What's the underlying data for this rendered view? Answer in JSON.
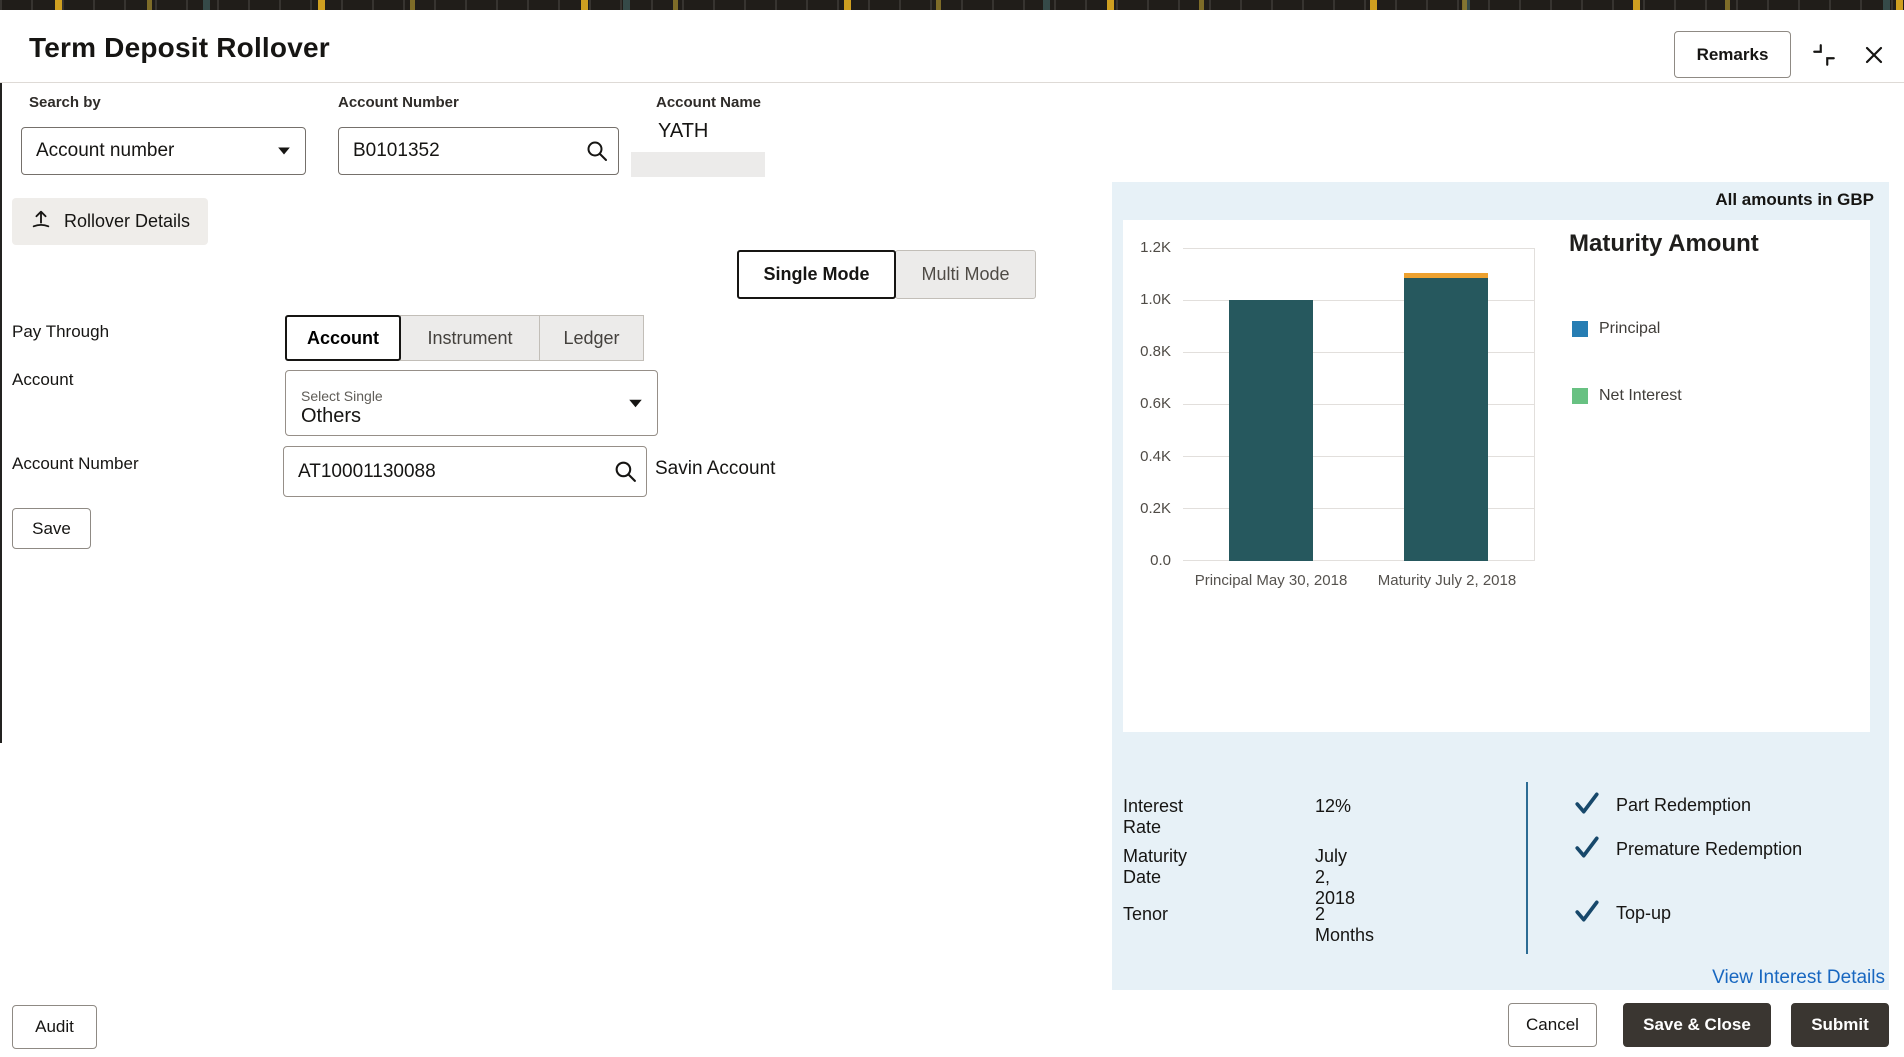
{
  "header": {
    "title": "Term Deposit Rollover",
    "remarks_label": "Remarks"
  },
  "search": {
    "search_by_label": "Search by",
    "search_by_value": "Account number",
    "account_number_label": "Account Number",
    "account_number_value": "B0101352",
    "account_name_label": "Account Name",
    "account_name_value": "YATH"
  },
  "form": {
    "rollover_details_label": "Rollover Details",
    "modes": {
      "single": "Single Mode",
      "multi": "Multi Mode",
      "selected": "Single Mode"
    },
    "pay_through_label": "Pay Through",
    "pay_through_tabs": [
      "Account",
      "Instrument",
      "Ledger"
    ],
    "pay_through_selected": "Account",
    "account_label": "Account",
    "account_select_label": "Select Single",
    "account_select_value": "Others",
    "account_number_label": "Account Number",
    "account_number_value": "AT10001130088",
    "account_number_hint": "Savin Account",
    "save_label": "Save"
  },
  "summary": {
    "amounts_note": "All amounts in GBP",
    "details": [
      {
        "label": "Interest Rate",
        "value": "12%"
      },
      {
        "label": "Maturity Date",
        "value": "July 2, 2018"
      },
      {
        "label": "Tenor",
        "value": "2 Months"
      }
    ],
    "flags": [
      "Part Redemption",
      "Premature Redemption",
      "Top-up"
    ],
    "view_interest_link": "View Interest Details"
  },
  "footer": {
    "audit_label": "Audit",
    "cancel_label": "Cancel",
    "save_close_label": "Save & Close",
    "submit_label": "Submit"
  },
  "chart_data": {
    "type": "bar",
    "title": "Maturity Amount",
    "categories": [
      "Principal May 30, 2018",
      "Maturity July 2, 2018"
    ],
    "series": [
      {
        "name": "Principal",
        "color": "#26585e",
        "values": [
          1000,
          1085
        ]
      },
      {
        "name": "Net Interest",
        "color": "#eda12f",
        "values": [
          0,
          20
        ]
      }
    ],
    "legend": [
      {
        "label": "Principal",
        "color": "#267db3"
      },
      {
        "label": "Net Interest",
        "color": "#68c182"
      }
    ],
    "ylim": [
      0,
      1200
    ],
    "yticks": [
      "1.2K",
      "1.0K",
      "0.8K",
      "0.6K",
      "0.4K",
      "0.2K",
      "0.0"
    ],
    "grid": true,
    "currency": "GBP",
    "legend_position": "right"
  },
  "colors": {
    "panel_bg": "#e7f1f7",
    "bar_teal": "#26585e",
    "bar_orange": "#eda12f",
    "check": "#17486b",
    "link": "#1867c0",
    "dark_button": "#3a3631"
  }
}
